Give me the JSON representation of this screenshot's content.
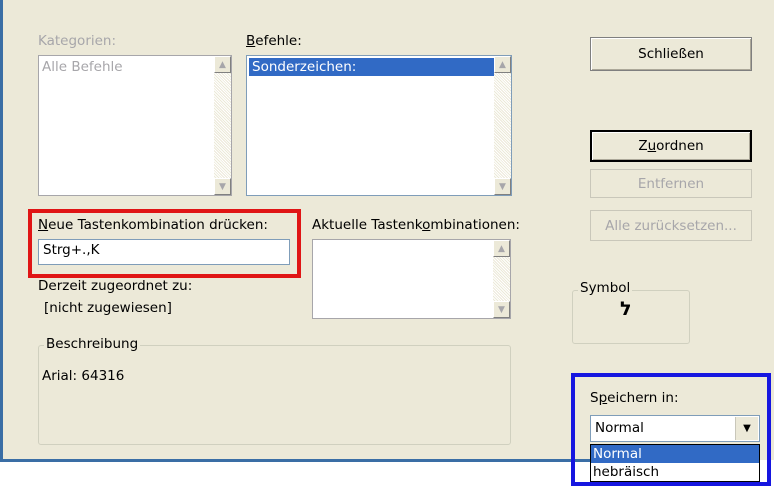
{
  "categories": {
    "label": "Kategorien:",
    "items": [
      "Alle Befehle"
    ]
  },
  "commands": {
    "label_prefix": "",
    "label_accel": "B",
    "label_rest": "efehle:",
    "items": [
      "Sonderzeichen:"
    ]
  },
  "new_shortcut": {
    "label_accel": "N",
    "label_rest": "eue Tastenkombination drücken:",
    "value": "Strg+.,K"
  },
  "current_shortcuts": {
    "label_prefix": "Aktuelle Tastenk",
    "label_accel": "o",
    "label_rest": "mbinationen:"
  },
  "assigned": {
    "label": "Derzeit zugeordnet zu:",
    "value": "[nicht zugewiesen]"
  },
  "description": {
    "label": "Beschreibung",
    "text": "Arial: 64316"
  },
  "buttons": {
    "close": "Schließen",
    "assign_prefix": "Z",
    "assign_accel": "u",
    "assign_rest": "ordnen",
    "remove": "Entfernen",
    "reset_all": "Alle zurücksetzen..."
  },
  "symbol": {
    "label": "Symbol",
    "glyph": "ל"
  },
  "save_in": {
    "label_prefix": "S",
    "label_accel": "p",
    "label_rest": "eichern in:",
    "selected": "Normal",
    "options": [
      "Normal",
      "hebräisch"
    ]
  }
}
